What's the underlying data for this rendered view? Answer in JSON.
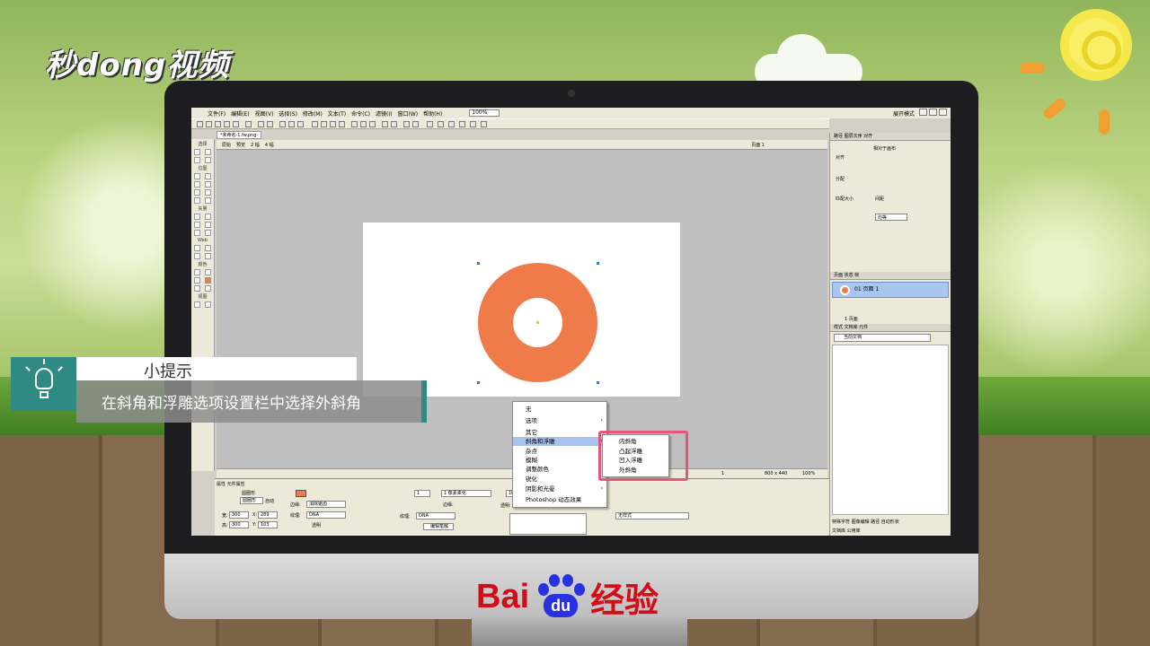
{
  "watermark": {
    "top_logo": "秒dong视频",
    "bottom_brand_left": "Bai",
    "bottom_brand_paw": "du",
    "bottom_brand_right": "经验"
  },
  "menubar": {
    "items": [
      "文件(F)",
      "编辑(E)",
      "视图(V)",
      "选择(S)",
      "修改(M)",
      "文本(T)",
      "命令(C)",
      "滤镜(I)",
      "窗口(W)",
      "帮助(H)"
    ],
    "zoom": "100%",
    "workspace": "展开模式"
  },
  "document": {
    "tab": "*未命名-1.fw.png",
    "view_tabs": [
      "原始",
      "预览",
      "2 幅",
      "4 幅"
    ],
    "page_label": "页面 1"
  },
  "tools": {
    "sections": [
      "选择",
      "位图",
      "矢量",
      "Web",
      "颜色",
      "视图"
    ]
  },
  "statusbar": {
    "page": "1",
    "size": "800 x 440",
    "zoom": "100%"
  },
  "properties": {
    "tabs": "属性   元件属性",
    "object": "圆圈形",
    "object_name": "圆圈形",
    "auto": "自动",
    "width_label": "宽:",
    "width": "300",
    "height_label": "高:",
    "height": "300",
    "x_label": "X:",
    "x": "289",
    "y_label": "Y:",
    "y": "103",
    "fill_edge_label": "边缘:",
    "fill_edge": "消除锯齿",
    "fill_texture_label": "纹理:",
    "fill_texture": "DNA",
    "transparent": "透明",
    "stroke_size": "1",
    "stroke_type": "1 像素柔化",
    "stroke_edge_label": "边缘:",
    "stroke_texture_label": "纹理:",
    "stroke_texture": "DNA",
    "edit_stroke": "编辑笔触",
    "opacity": "100",
    "blend_label": "透明:",
    "style": "无样式",
    "accent_color": "#f07b4a"
  },
  "right_panel": {
    "align_tabs": "路径   图层次序   对齐",
    "align_to": "相对于画布",
    "align": "对齐",
    "distribute": "分配",
    "match_size": "匹配大小",
    "spacing": "间距",
    "spacing_value": "均等",
    "pages_tabs": "页面   状态   帧",
    "page_item": "01 页面 1",
    "page_count": "1 页面",
    "styles_tabs": "样式   文档库   元件",
    "current_doc": "当前文档",
    "bottom_tabs": "特殊字符   图像编辑   路径   自动形状",
    "bottom_tabs2": "文档库   公用库"
  },
  "context_menu": {
    "items": [
      "无",
      "选项",
      "其它",
      "斜角和浮雕",
      "杂点",
      "模糊",
      "调整颜色",
      "锐化",
      "阴影和光晕",
      "Photoshop 动态效果"
    ],
    "highlighted": "斜角和浮雕"
  },
  "submenu": {
    "items": [
      "内斜角",
      "凸起浮雕",
      "凹入浮雕",
      "外斜角"
    ]
  },
  "tip": {
    "title": "小提示",
    "body": "在斜角和浮雕选项设置栏中选择外斜角"
  }
}
